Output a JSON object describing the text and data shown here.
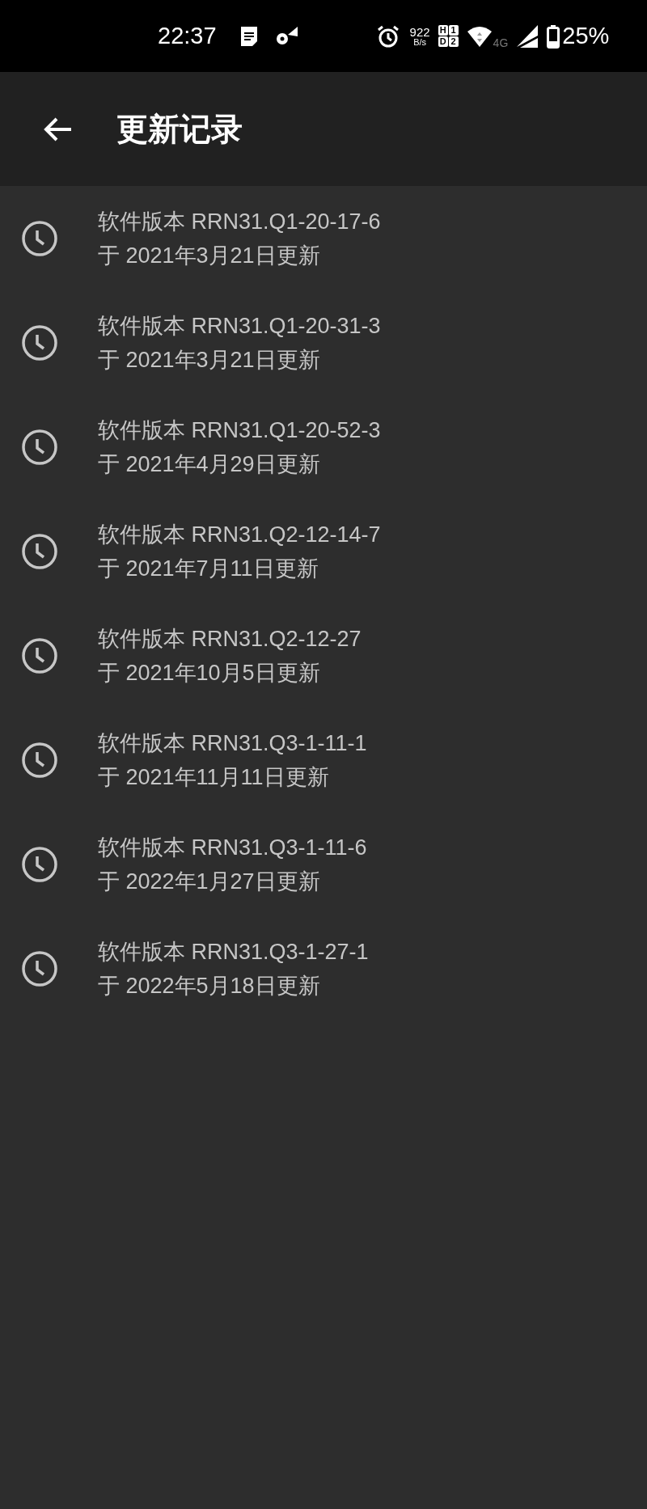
{
  "status_bar": {
    "time": "22:37",
    "net_speed": "922",
    "net_speed_unit": "B/s",
    "sim_labels": [
      "H",
      "1",
      "D",
      "2"
    ],
    "network_type": "4G",
    "battery": "25%"
  },
  "app_bar": {
    "title": "更新记录"
  },
  "updates": [
    {
      "version": "软件版本 RRN31.Q1-20-17-6",
      "date": "于 2021年3月21日更新"
    },
    {
      "version": "软件版本 RRN31.Q1-20-31-3",
      "date": "于 2021年3月21日更新"
    },
    {
      "version": "软件版本 RRN31.Q1-20-52-3",
      "date": "于 2021年4月29日更新"
    },
    {
      "version": "软件版本 RRN31.Q2-12-14-7",
      "date": "于 2021年7月11日更新"
    },
    {
      "version": "软件版本 RRN31.Q2-12-27",
      "date": "于 2021年10月5日更新"
    },
    {
      "version": "软件版本 RRN31.Q3-1-11-1",
      "date": "于 2021年11月11日更新"
    },
    {
      "version": "软件版本 RRN31.Q3-1-11-6",
      "date": "于 2022年1月27日更新"
    },
    {
      "version": "软件版本 RRN31.Q3-1-27-1",
      "date": "于 2022年5月18日更新"
    }
  ]
}
